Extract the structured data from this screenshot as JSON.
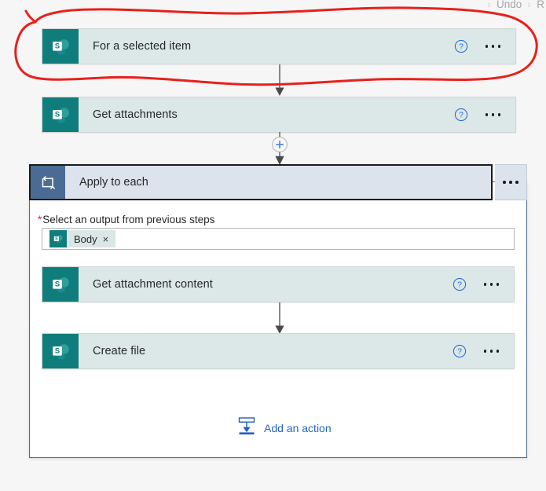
{
  "topbar": {
    "undo_label": "Undo",
    "chevron": "›",
    "trailing_partial": "R"
  },
  "colors": {
    "canvas": "#f6f6f6",
    "card_bg": "#dce8e7",
    "card_border": "#cdd6d5",
    "sharepoint_teal": "#0f7d7c",
    "loop_icon_blue": "#4a6c94",
    "loop_header_bg": "#dde3ec",
    "loop_container_border": "#4a6c94",
    "link_blue": "#2566c7",
    "help_blue": "#2b6fd6",
    "required_red": "#e31c3d",
    "annotation_red": "#e8201c",
    "arrow_gray": "#4a4a4a",
    "plus_blue": "#3b7fd4"
  },
  "cards": [
    {
      "id": "for-a-selected-item",
      "title": "For a selected item",
      "icon": "sharepoint-icon",
      "help_icon": "help-circle-icon",
      "menu_icon": "ellipsis-icon",
      "highlighted": true
    },
    {
      "id": "get-attachments",
      "title": "Get attachments",
      "icon": "sharepoint-icon",
      "help_icon": "help-circle-icon",
      "menu_icon": "ellipsis-icon",
      "highlighted": false
    }
  ],
  "connector_plus": {
    "icon": "plus-circle-icon",
    "label": "insert-new-step"
  },
  "loop": {
    "title": "Apply to each",
    "icon": "loop-icon",
    "menu_icon": "ellipsis-icon",
    "field": {
      "required_marker": "*",
      "label": "Select an output from previous steps",
      "token": {
        "icon": "sharepoint-icon",
        "label": "Body",
        "remove_icon": "×"
      }
    },
    "inner_cards": [
      {
        "id": "get-attachment-content",
        "title": "Get attachment content",
        "icon": "sharepoint-icon",
        "help_icon": "help-circle-icon",
        "menu_icon": "ellipsis-icon"
      },
      {
        "id": "create-file",
        "title": "Create file",
        "icon": "sharepoint-icon",
        "help_icon": "help-circle-icon",
        "menu_icon": "ellipsis-icon"
      }
    ],
    "add_action": {
      "label": "Add an action",
      "icon": "add-action-icon"
    }
  },
  "annotation": {
    "type": "hand-drawn-ellipse",
    "target": "for-a-selected-item",
    "color": "#e8201c"
  }
}
